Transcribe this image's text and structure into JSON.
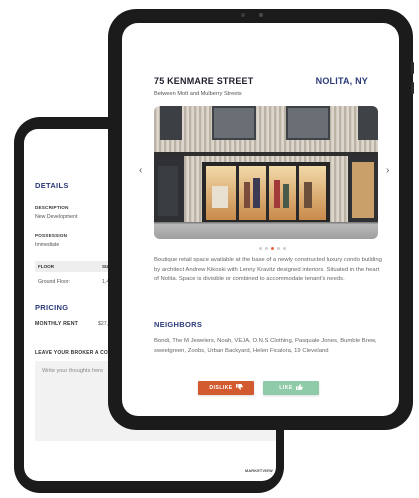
{
  "back_screen": {
    "details_title": "DETAILS",
    "description_label": "DESCRIPTION",
    "description_value": "New Development",
    "possession_label": "POSSESSION",
    "possession_value": "Immediate",
    "table": {
      "headers": [
        "FLOOR",
        "SIZE"
      ],
      "row": {
        "floor": "Ground Floor:",
        "size": "1,484 S"
      }
    },
    "pricing_title": "PRICING",
    "monthly_rent_label": "MONTHLY RENT",
    "monthly_rent_value": "$27,825",
    "broker_label": "LEAVE YOUR BROKER A CO",
    "broker_placeholder": "Write your thoughts here",
    "logo": "MARKETVIEW"
  },
  "front_screen": {
    "address": "75 KENMARE STREET",
    "neighborhood": "NOLITA, NY",
    "subaddress": "Between Mott and Mulberry Streets",
    "carousel": {
      "slide_count": 5,
      "active_index": 2,
      "prev_arrow": "‹",
      "next_arrow": "›"
    },
    "description": "Boutique retail space available at the base of a newly constructed luxury condo building by architect Andrew Kikoski with Lenny Kravitz designed interiors. Situated in the heart of Nolita. Space is divisible or combined to accommodate tenant's needs.",
    "neighbors_title": "NEIGHBORS",
    "neighbors_text": "Bondi, The M Jewelers, Noah, VEJA, O.N.S Clothing, Pasquale Jones, Bumble Brew, sweetgreen, Zoobs, Urban Backyard, Helen Ficalora, 19 Cleveland",
    "dislike_label": "DISLIKE",
    "like_label": "LIKE",
    "dislike_icon": "thumbs-down-icon",
    "like_icon": "thumbs-up-icon"
  },
  "colors": {
    "accent_navy": "#2b3a7a",
    "dislike": "#d25a2e",
    "like": "#8fcba9",
    "device_frame": "#1b1b1b"
  }
}
